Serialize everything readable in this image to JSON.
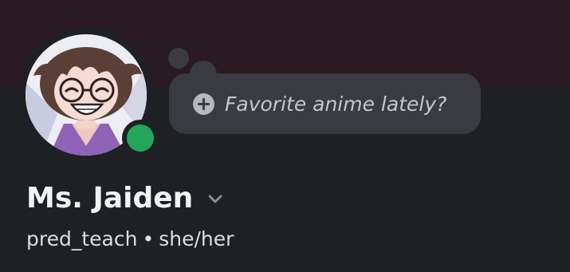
{
  "profile": {
    "display_name": "Ms. Jaiden",
    "username": "pred_teach",
    "separator": "•",
    "pronouns": "she/her",
    "custom_status_placeholder": "Favorite anime lately?",
    "online_status": "online"
  },
  "icons": {
    "status_add": "plus-circle-icon",
    "name_dropdown": "chevron-down-icon"
  },
  "colors": {
    "background": "#1f2024",
    "banner": "#2a1b22",
    "bubble": "#393b41",
    "online_green": "#23a55a",
    "name_text": "#f2f3f5",
    "secondary_text": "#dbdee1"
  }
}
